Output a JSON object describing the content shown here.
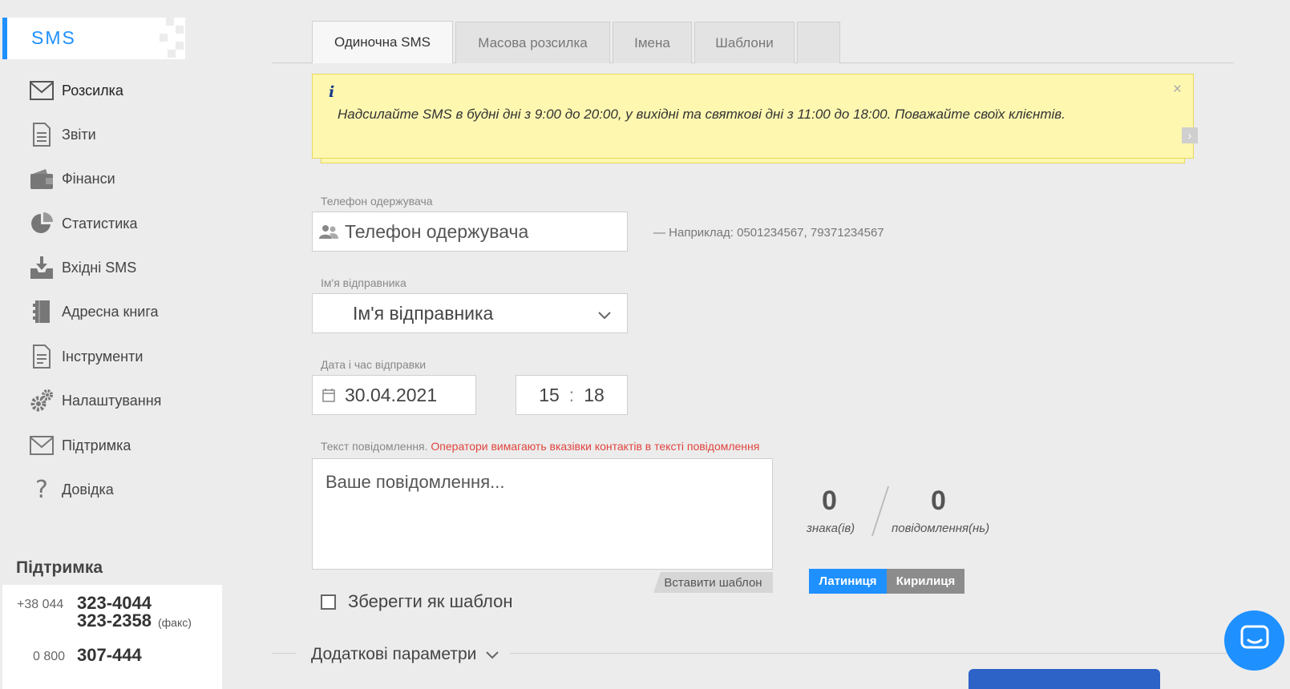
{
  "app": {
    "logo_text": "SMS",
    "accent": "#1e90ff"
  },
  "sidebar": {
    "items": [
      {
        "label": "Розсилка",
        "icon": "envelope-icon"
      },
      {
        "label": "Звіти",
        "icon": "document-icon"
      },
      {
        "label": "Фінанси",
        "icon": "wallet-icon"
      },
      {
        "label": "Статистика",
        "icon": "pie-chart-icon"
      },
      {
        "label": "Вхідні SMS",
        "icon": "inbox-download-icon"
      },
      {
        "label": "Адресна книга",
        "icon": "address-book-icon"
      },
      {
        "label": "Інструменти",
        "icon": "tools-document-icon"
      },
      {
        "label": "Налаштування",
        "icon": "gears-icon"
      },
      {
        "label": "Підтримка",
        "icon": "support-envelope-icon"
      },
      {
        "label": "Довідка",
        "icon": "question-icon"
      }
    ],
    "support": {
      "title": "Підтримка",
      "code1": "+38 044",
      "num1": "323-4044",
      "num2": "323-2358",
      "num2_note": "(факс)",
      "code2": "0 800",
      "num3": "307-444"
    }
  },
  "tabs": [
    {
      "label": "Одиночна SMS",
      "active": true
    },
    {
      "label": "Масова розсилка",
      "active": false
    },
    {
      "label": "Імена",
      "active": false
    },
    {
      "label": "Шаблони",
      "active": false
    },
    {
      "label": "",
      "active": false
    }
  ],
  "alert": {
    "icon": "i",
    "text": "Надсилайте SMS в будні дні з 9:00 до 20:00, у вихідні та святкові дні з 11:00 до 18:00. Поважайте своїх клієнтів.",
    "close": "×",
    "arrow": "›"
  },
  "form": {
    "phone": {
      "label": "Телефон одержувача",
      "placeholder": "Телефон одержувача",
      "hint": "— Наприклад: 0501234567, 79371234567"
    },
    "sender": {
      "label": "Ім'я відправника",
      "value": "Ім'я відправника"
    },
    "datetime": {
      "label": "Дата і час відправки",
      "date": "30.04.2021",
      "hour": "15",
      "sep": ":",
      "minute": "18"
    },
    "message": {
      "label": "Текст повідомлення.",
      "warning": "Оператори вимагають вказівки контактів в тексті повідомлення",
      "placeholder": "Ваше повідомлення...",
      "insert_template": "Вставити шаблон"
    },
    "save_template": "Зберегти як шаблон",
    "counters": {
      "chars": "0",
      "chars_label": "знака(ів)",
      "messages": "0",
      "messages_label": "повідомлення(нь)"
    },
    "alphabet": {
      "latin": "Латиниця",
      "cyrillic": "Кирилиця",
      "selected": "Латиниця"
    },
    "extra": "Додаткові параметри"
  }
}
